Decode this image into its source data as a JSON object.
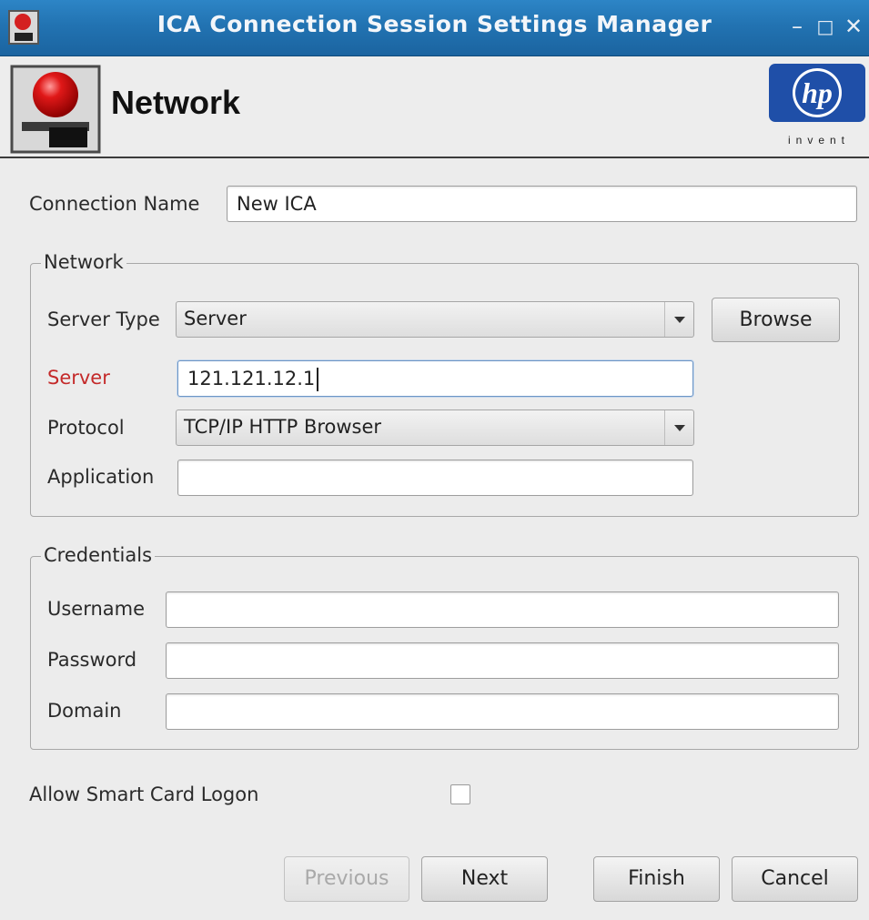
{
  "window": {
    "title": "ICA Connection Session Settings Manager",
    "controls": {
      "minimize": "–",
      "maximize": "□",
      "close": "✕"
    }
  },
  "header": {
    "title": "Network",
    "logo_text": "hp",
    "logo_tagline": "invent"
  },
  "form": {
    "connection_name": {
      "label": "Connection Name",
      "value": "New ICA"
    },
    "network_group": {
      "title": "Network",
      "server_type": {
        "label": "Server Type",
        "value": "Server"
      },
      "browse_button": "Browse",
      "server": {
        "label": "Server",
        "value": "121.121.12.1"
      },
      "protocol": {
        "label": "Protocol",
        "value": "TCP/IP HTTP Browser"
      },
      "application": {
        "label": "Application",
        "value": ""
      }
    },
    "credentials_group": {
      "title": "Credentials",
      "username": {
        "label": "Username",
        "value": ""
      },
      "password": {
        "label": "Password",
        "value": ""
      },
      "domain": {
        "label": "Domain",
        "value": ""
      }
    },
    "smart_card": {
      "label": "Allow Smart Card Logon",
      "checked": false
    }
  },
  "buttons": {
    "previous": "Previous",
    "next": "Next",
    "finish": "Finish",
    "cancel": "Cancel"
  },
  "colors": {
    "titlebar": "#2273b2",
    "required_label": "#c42a2a",
    "hp_blue": "#1f4fa8"
  }
}
